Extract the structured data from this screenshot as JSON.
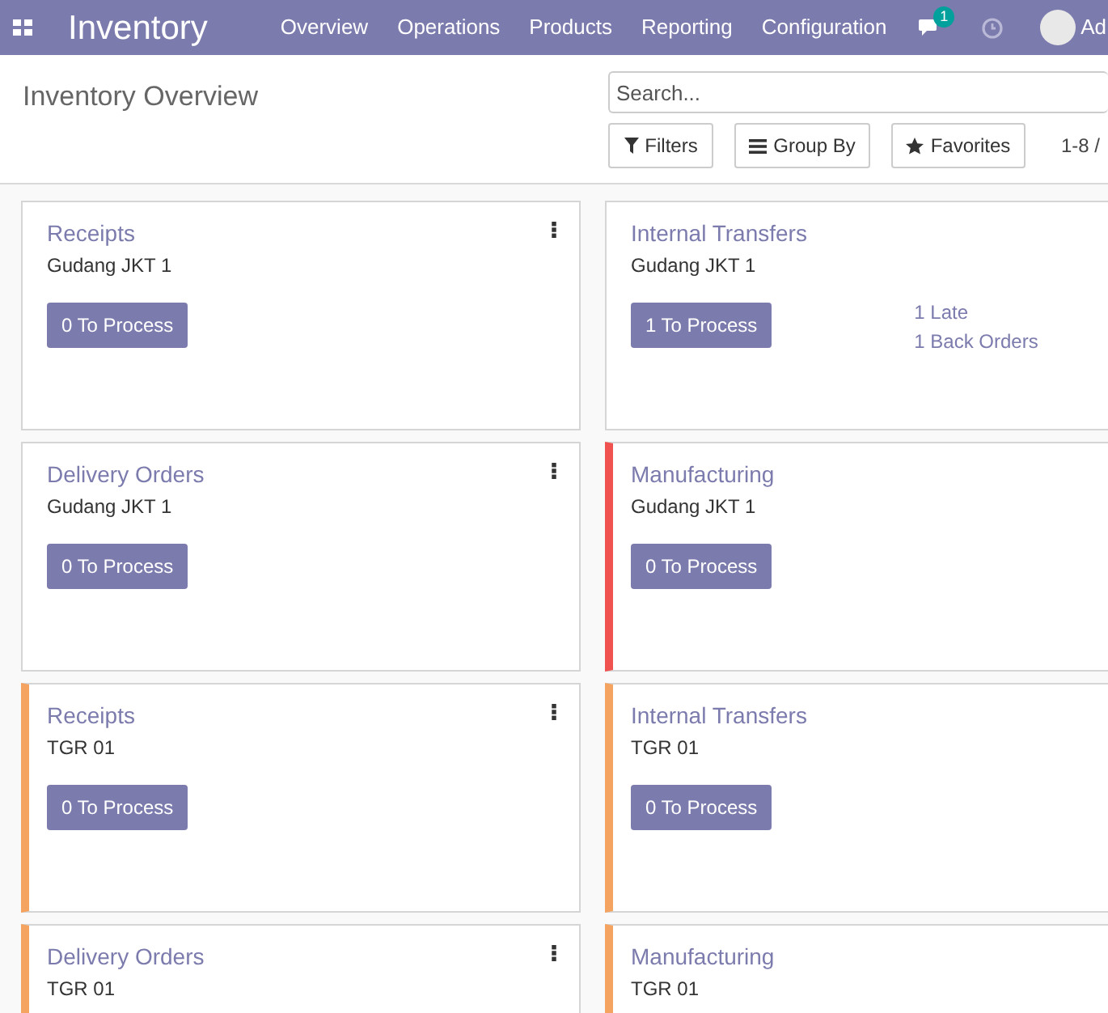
{
  "navbar": {
    "app_name": "Inventory",
    "menu": [
      "Overview",
      "Operations",
      "Products",
      "Reporting",
      "Configuration"
    ],
    "messages_count": "1",
    "user": "Ad"
  },
  "control_panel": {
    "title": "Inventory Overview",
    "search": {
      "placeholder": "Search..."
    },
    "buttons": [
      "Filters",
      "Group By",
      "Favorites"
    ],
    "pager": "1-8 /"
  },
  "cards": [
    {
      "title": "Receipts",
      "warehouse": "Gudang JKT 1",
      "action": "0 To Process"
    },
    {
      "title": "Internal Transfers",
      "warehouse": "Gudang JKT 1",
      "action": "1 To Process",
      "links": [
        "1 Late",
        "1 Back Orders"
      ]
    },
    {
      "title": "Delivery Orders",
      "warehouse": "Gudang JKT 1",
      "action": "0 To Process"
    },
    {
      "title": "Manufacturing",
      "warehouse": "Gudang JKT 1",
      "action": "0 To Process",
      "color": "#f0524f"
    },
    {
      "title": "Receipts",
      "warehouse": "TGR 01",
      "action": "0 To Process",
      "color": "#f4a460"
    },
    {
      "title": "Internal Transfers",
      "warehouse": "TGR 01",
      "action": "0 To Process",
      "color": "#f4a460"
    },
    {
      "title": "Delivery Orders",
      "warehouse": "TGR 01",
      "color": "#f4a460"
    },
    {
      "title": "Manufacturing",
      "warehouse": "TGR 01",
      "color": "#f4a460"
    }
  ]
}
